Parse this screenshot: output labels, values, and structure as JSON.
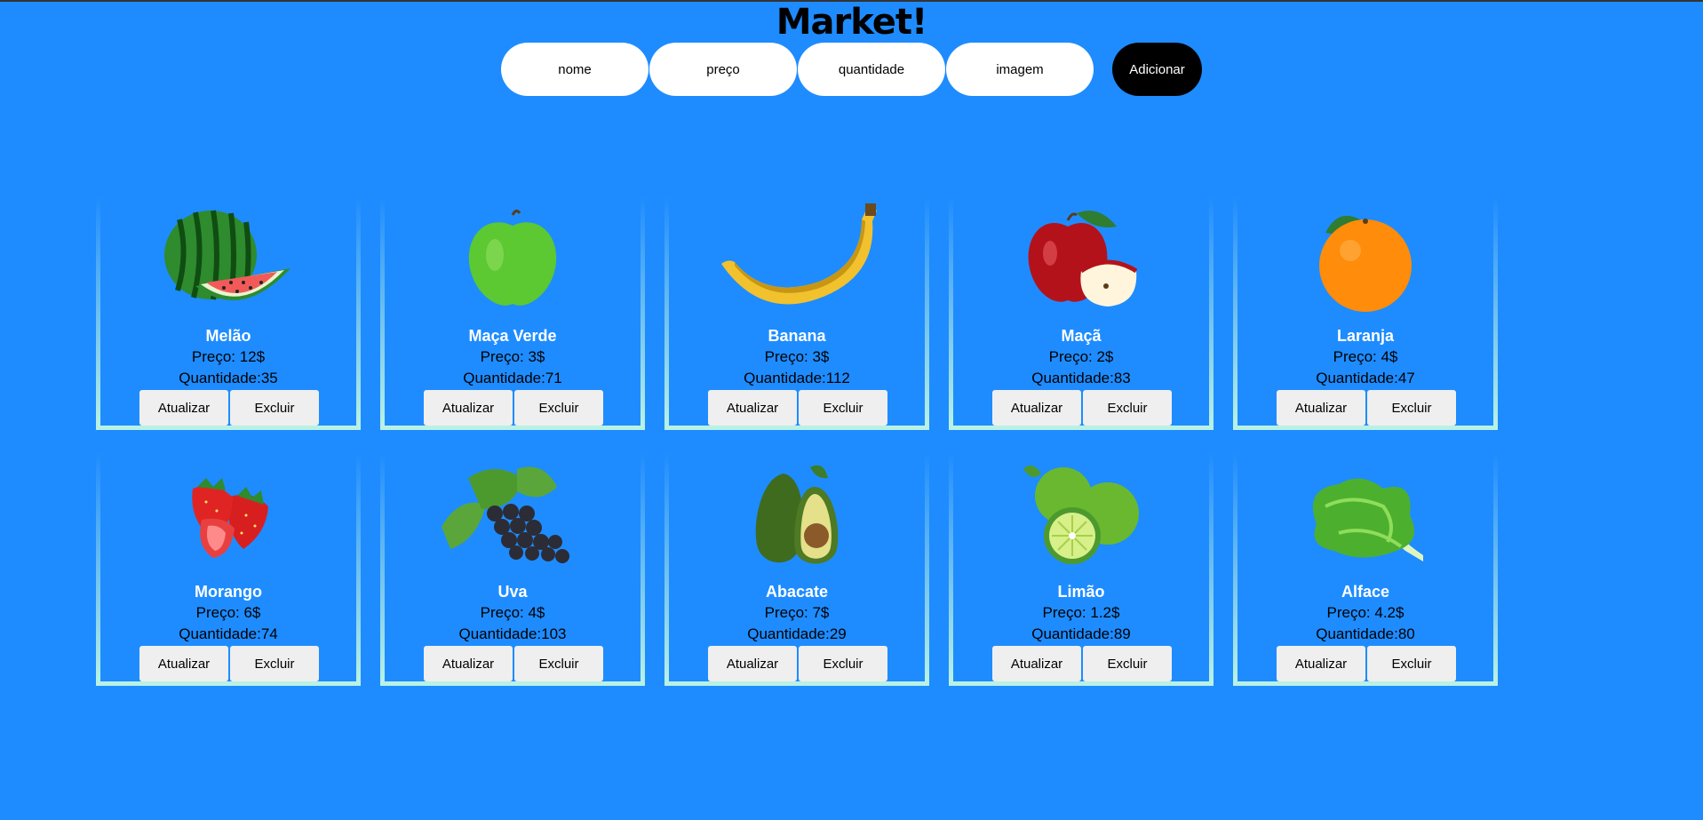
{
  "title": "Market!",
  "form": {
    "name_placeholder": "nome",
    "price_placeholder": "preço",
    "quantity_placeholder": "quantidade",
    "image_placeholder": "imagem",
    "add_label": "Adicionar"
  },
  "products": [
    {
      "name": "Melão",
      "price": "Preço: 12$",
      "qty": "Quantidade:35",
      "icon": "watermelon-icon",
      "update": "Atualizar",
      "delete": "Excluir"
    },
    {
      "name": "Maça Verde",
      "price": "Preço: 3$",
      "qty": "Quantidade:71",
      "icon": "green-apple-icon",
      "update": "Atualizar",
      "delete": "Excluir"
    },
    {
      "name": "Banana",
      "price": "Preço: 3$",
      "qty": "Quantidade:112",
      "icon": "banana-icon",
      "update": "Atualizar",
      "delete": "Excluir"
    },
    {
      "name": "Maçã",
      "price": "Preço: 2$",
      "qty": "Quantidade:83",
      "icon": "red-apple-icon",
      "update": "Atualizar",
      "delete": "Excluir"
    },
    {
      "name": "Laranja",
      "price": "Preço: 4$",
      "qty": "Quantidade:47",
      "icon": "orange-icon",
      "update": "Atualizar",
      "delete": "Excluir"
    },
    {
      "name": "Morango",
      "price": "Preço: 6$",
      "qty": "Quantidade:74",
      "icon": "strawberry-icon",
      "update": "Atualizar",
      "delete": "Excluir"
    },
    {
      "name": "Uva",
      "price": "Preço: 4$",
      "qty": "Quantidade:103",
      "icon": "grapes-icon",
      "update": "Atualizar",
      "delete": "Excluir"
    },
    {
      "name": "Abacate",
      "price": "Preço: 7$",
      "qty": "Quantidade:29",
      "icon": "avocado-icon",
      "update": "Atualizar",
      "delete": "Excluir"
    },
    {
      "name": "Limão",
      "price": "Preço: 1.2$",
      "qty": "Quantidade:89",
      "icon": "lime-icon",
      "update": "Atualizar",
      "delete": "Excluir"
    },
    {
      "name": "Alface",
      "price": "Preço: 4.2$",
      "qty": "Quantidade:80",
      "icon": "lettuce-icon",
      "update": "Atualizar",
      "delete": "Excluir"
    }
  ],
  "colors": {
    "background": "#1e8cff",
    "card_border": "#b9f2e4",
    "add_button": "#000000",
    "action_button": "#efefef"
  }
}
